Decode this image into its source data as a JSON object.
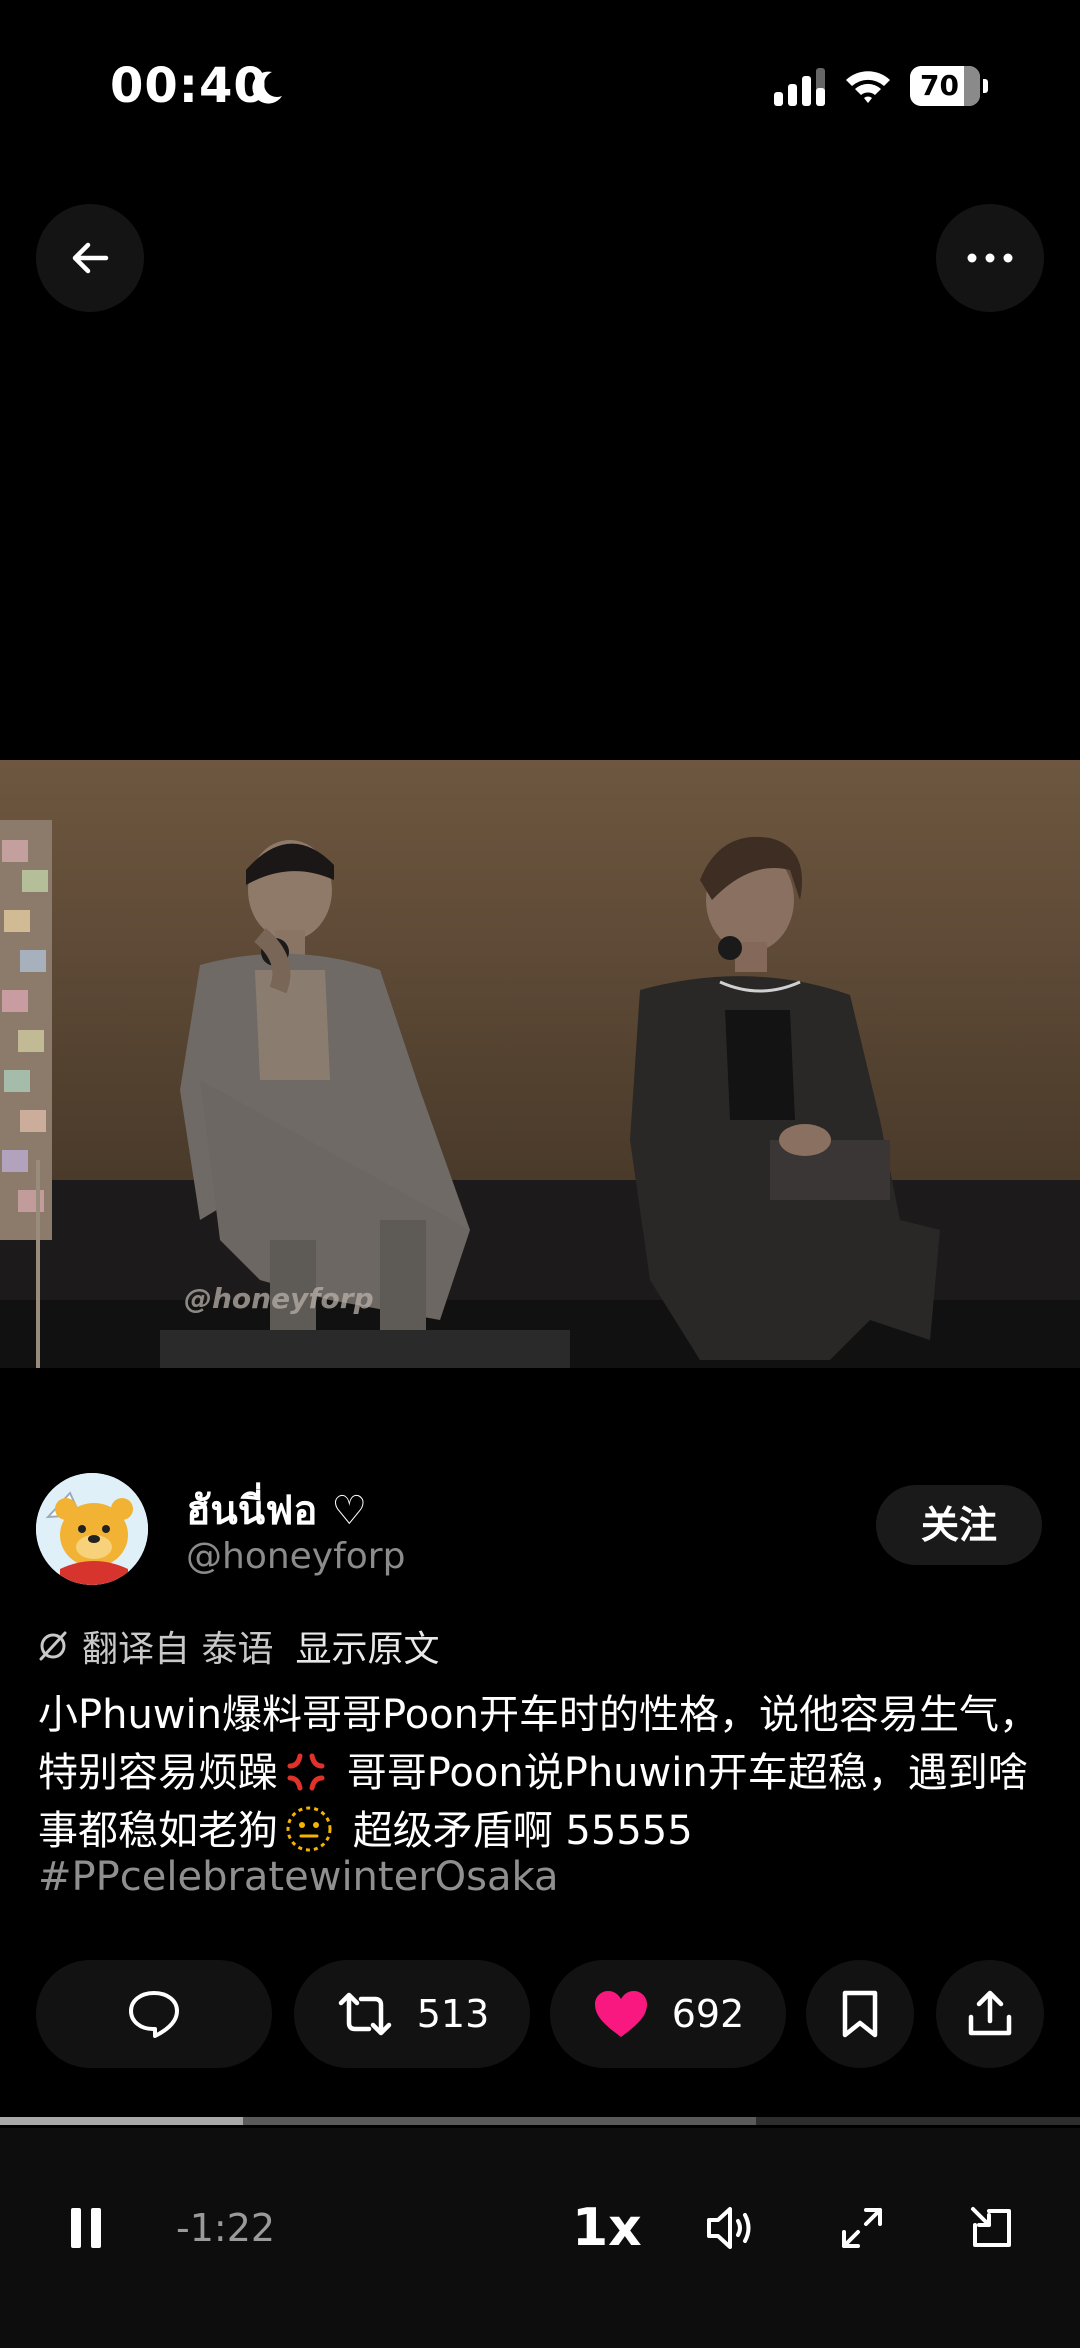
{
  "status_bar": {
    "time": "00:40",
    "battery": "70"
  },
  "post": {
    "author_name": "ฮันนี่ฟอ ♡",
    "author_handle": "@honeyforp",
    "follow_label": "关注",
    "translated_from": "翻译自 泰语",
    "show_original": "显示原文",
    "text_part1": "小Phuwin爆料哥哥Poon开车时的性格，说他容易生气，特别容易烦躁",
    "text_part2": " 哥哥Poon说Phuwin开车超稳，遇到啥事都稳如老狗",
    "text_part3": " 超级矛盾啊 55555",
    "hashtag": "#PPcelebratewinterOsaka",
    "watermark": "@honeyforp"
  },
  "actions": {
    "reposts": "513",
    "likes": "692",
    "like_color": "#f91880"
  },
  "player": {
    "progress": 0.225,
    "buffered": 0.7,
    "remaining": "-1:22",
    "speed": "1x"
  },
  "icons": {
    "back": "arrow-left-icon",
    "more": "more-horizontal-icon",
    "reply": "speech-bubble-icon",
    "repost": "repost-arrows-icon",
    "like": "heart-icon",
    "bookmark": "bookmark-icon",
    "share": "share-upload-icon",
    "pause": "pause-icon",
    "volume": "volume-icon",
    "fullscreen": "expand-icon",
    "pip": "exit-rotate-icon"
  }
}
